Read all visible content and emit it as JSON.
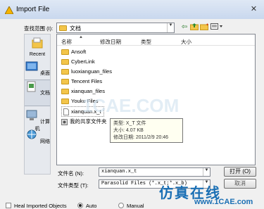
{
  "window": {
    "title": "Import File",
    "close_glyph": "✕"
  },
  "lookin": {
    "label": "查找范围 (I):",
    "value": "文档"
  },
  "toolbar": {
    "back_icon": "back-icon",
    "up_icon": "up-folder-icon",
    "newfolder_icon": "new-folder-icon",
    "views_icon": "views-menu-icon"
  },
  "places": [
    {
      "label": "Recent",
      "icon": "recent-icon"
    },
    {
      "label": "桌面",
      "icon": "desktop-icon"
    },
    {
      "label": "文档",
      "icon": "documents-icon"
    },
    {
      "label": "计算机",
      "icon": "computer-icon"
    },
    {
      "label": "网络",
      "icon": "network-icon"
    }
  ],
  "list": {
    "columns": [
      "名称",
      "修改日期",
      "类型",
      "大小"
    ],
    "items": [
      {
        "name": "Ansoft",
        "kind": "folder"
      },
      {
        "name": "CyberLink",
        "kind": "folder"
      },
      {
        "name": "luoxianguan_files",
        "kind": "folder"
      },
      {
        "name": "Tencent Files",
        "kind": "folder"
      },
      {
        "name": "xianquan_files",
        "kind": "folder"
      },
      {
        "name": "Youku Files",
        "kind": "folder"
      },
      {
        "name": "xianquan.x_t",
        "kind": "file"
      },
      {
        "name": "我的共享文件夹",
        "kind": "shared"
      }
    ]
  },
  "tooltip": {
    "type": "类型: X_T 文件",
    "size": "大小: 4.07 KB",
    "modified": "修改日期: 2011/2/9 20:46"
  },
  "filename": {
    "label": "文件名 (N):",
    "value": "xianquan.x_t"
  },
  "filetype": {
    "label": "文件类型 (T):",
    "value": "Parasolid Files (*.x_t;*.x_b)"
  },
  "buttons": {
    "open": "打开 (O)",
    "cancel": "取消"
  },
  "options": {
    "heal": "Heal Imported Objects",
    "auto": "Auto",
    "manual": "Manual"
  },
  "watermark": {
    "main": "仿真在线",
    "url": "www.1CAE.com",
    "mid": "1CAE.COM"
  }
}
